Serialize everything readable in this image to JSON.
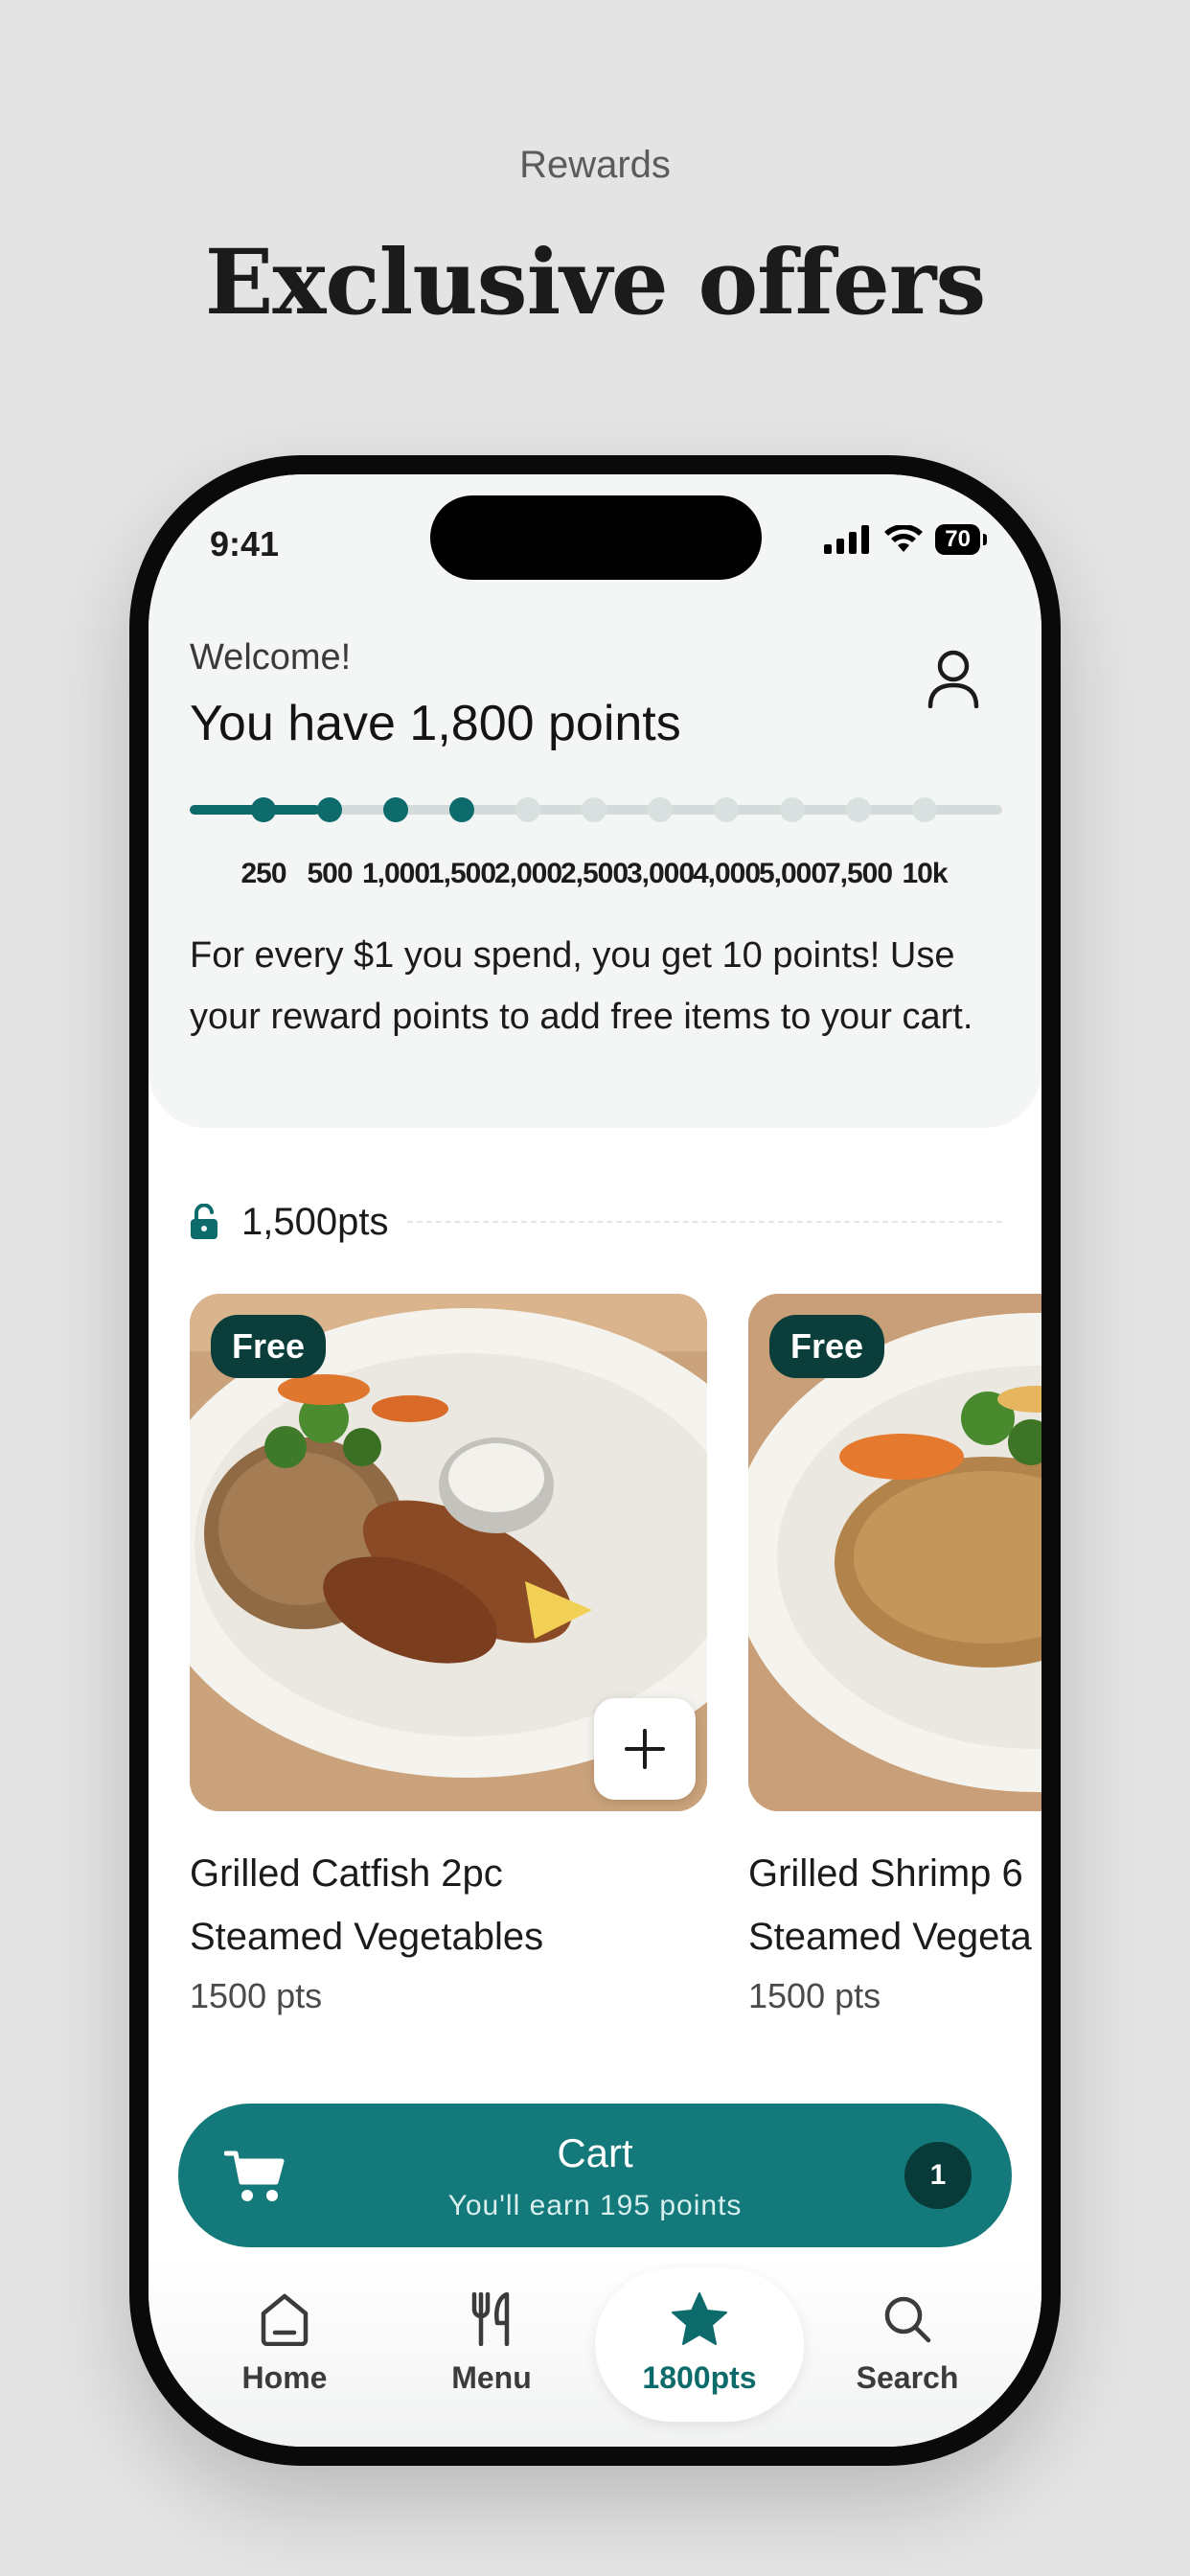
{
  "header": {
    "eyebrow": "Rewards",
    "title": "Exclusive offers"
  },
  "status_bar": {
    "time": "9:41",
    "battery": "70"
  },
  "rewards": {
    "welcome": "Welcome!",
    "points_title": "You have 1,800 points",
    "current_points": 1800,
    "progress_fraction": 0.16,
    "milestones": [
      "250",
      "500",
      "1,000",
      "1,500",
      "2,000",
      "2,500",
      "3,000",
      "4,000",
      "5,000",
      "7,500",
      "10k"
    ],
    "milestones_reached": 4,
    "info_text": "For every $1 you spend, you get 10 points! Use your reward points to add free items to your cart."
  },
  "tier": {
    "label": "1,500pts"
  },
  "items": [
    {
      "badge": "Free",
      "name_line1": "Grilled Catfish 2pc",
      "name_line2": "Steamed Vegetables",
      "pts": "1500 pts"
    },
    {
      "badge": "Free",
      "name_line1": "Grilled Shrimp 6",
      "name_line2": "Steamed Vegeta",
      "pts": "1500 pts"
    }
  ],
  "cart": {
    "title": "Cart",
    "subtitle": "You'll earn 195 points",
    "count": "1"
  },
  "nav": {
    "home": "Home",
    "menu": "Menu",
    "rewards": "1800pts",
    "search": "Search"
  },
  "colors": {
    "accent": "#0e6b6b",
    "cart": "#14797a",
    "badge": "#0b3d3b"
  }
}
